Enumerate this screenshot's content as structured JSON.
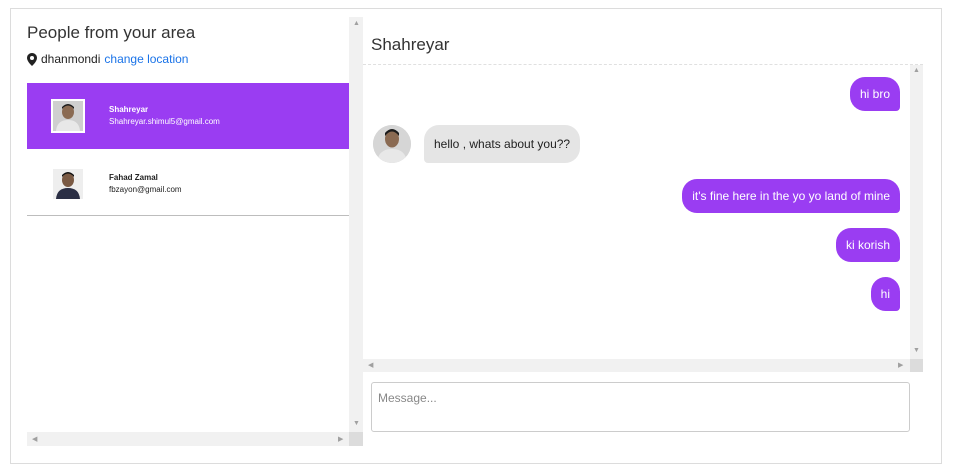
{
  "sidebar": {
    "title": "People from your area",
    "location": "dhanmondi",
    "change_location": "change location",
    "contacts": [
      {
        "name": "Shahreyar",
        "email": "Shahreyar.shimul5@gmail.com",
        "active": true
      },
      {
        "name": "Fahad Zamal",
        "email": "fbzayon@gmail.com",
        "active": false
      }
    ]
  },
  "chat": {
    "title": "Shahreyar",
    "messages": [
      {
        "direction": "out",
        "text": "hi bro"
      },
      {
        "direction": "in",
        "text": "hello , whats about you??"
      },
      {
        "direction": "out",
        "text": "it's fine here in the yo yo land of mine"
      },
      {
        "direction": "out",
        "text": "ki korish"
      },
      {
        "direction": "out",
        "text": "hi"
      }
    ],
    "input_placeholder": "Message..."
  },
  "colors": {
    "accent": "#9a3df2",
    "incoming_bubble": "#e5e5e5",
    "link": "#1a73e8"
  },
  "icons": {
    "location": "map-marker-icon"
  }
}
